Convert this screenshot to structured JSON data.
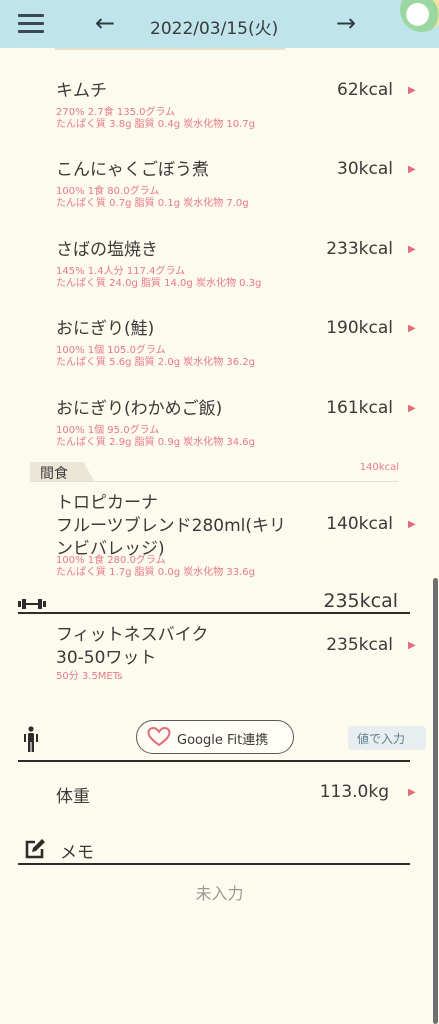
{
  "header": {
    "prev_arrow": "←",
    "date": "2022/03/15(火)",
    "next_arrow": "→"
  },
  "foods": [
    {
      "name": "キムチ",
      "kcal": "62kcal",
      "line1": "270% 2.7食 135.0グラム",
      "line2": "たんぱく質 3.8g 脂質 0.4g 炭水化物 10.7g"
    },
    {
      "name": "こんにゃくごぼう煮",
      "kcal": "30kcal",
      "line1": "100% 1食 80.0グラム",
      "line2": "たんぱく質 0.7g 脂質 0.1g 炭水化物 7.0g"
    },
    {
      "name": "さばの塩焼き",
      "kcal": "233kcal",
      "line1": "145% 1.4人分 117.4グラム",
      "line2": "たんぱく質 24.0g 脂質 14.0g 炭水化物 0.3g"
    },
    {
      "name": "おにぎり(鮭)",
      "kcal": "190kcal",
      "line1": "100% 1個 105.0グラム",
      "line2": "たんぱく質 5.6g 脂質 2.0g 炭水化物 36.2g"
    },
    {
      "name": "おにぎり(わかめご飯)",
      "kcal": "161kcal",
      "line1": "100% 1個 95.0グラム",
      "line2": "たんぱく質 2.9g 脂質 0.9g 炭水化物 34.6g"
    }
  ],
  "snack": {
    "label": "間食",
    "kcal": "140kcal",
    "item": {
      "name": "トロピカーナ\nフルーツブレンド280ml(キリ\nンビバレッジ)",
      "kcal": "140kcal",
      "line1": "100% 1食 280.0グラム",
      "line2": "たんぱく質 1.7g 脂質 0.0g 炭水化物 33.6g"
    }
  },
  "exercise": {
    "total": "235kcal",
    "item": {
      "name": "フィットネスバイク\n30-50ワット",
      "kcal": "235kcal",
      "detail": "50分 3.5METs"
    }
  },
  "google_fit": {
    "label": "Google Fit連携",
    "input_button": "値で入力"
  },
  "weight": {
    "label": "体重",
    "value": "113.0kg"
  },
  "memo": {
    "label": "メモ",
    "empty": "未入力"
  },
  "colors": {
    "header_bg": "#bfe4ec",
    "accent_pink": "#e67b86",
    "page_bg": "#fdfaee"
  }
}
